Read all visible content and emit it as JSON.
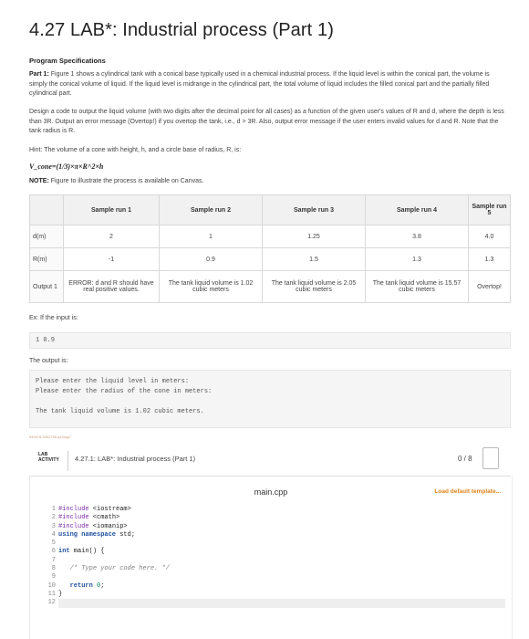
{
  "title": "4.27 LAB*: Industrial process (Part 1)",
  "spec": {
    "heading": "Program Specifications",
    "part1_label": "Part 1:",
    "part1_text": " Figure 1 shows a cylindrical tank with a conical base typically used in a chemical industrial process. If the liquid level is within the conical part, the volume is simply the conical volume of liquid. If the liquid level is midrange in the cylindrical part, the total volume of liquid includes the filled conical part and the partially filled cylindrical part.",
    "design_text": "Design a code to output the liquid volume (with two digits after the decimal point for all cases) as a function of the given user's values of R and d, where the depth is less than 3R. Output an error message (Overtop!) if you overtop the tank, i.e., d > 3R. Also, output error message if the user enters invalid values for d and R. Note that the tank radius is R.",
    "hint": "Hint: The volume of a cone with height, h, and a circle base of radius, R, is:",
    "formula": "V_cone=(1/3)×π×R^2×h",
    "note_label": "NOTE:",
    "note_text": " Figure to illustrate the process is available on Canvas."
  },
  "table": {
    "headers": [
      "",
      "Sample run 1",
      "Sample run 2",
      "Sample run 3",
      "Sample run 4",
      "Sample run 5"
    ],
    "rows": [
      {
        "label": "d(m)",
        "cells": [
          "2",
          "1",
          "1.25",
          "3.8",
          "4.0"
        ]
      },
      {
        "label": "R(m)",
        "cells": [
          "-1",
          "0.9",
          "1.5",
          "1.3",
          "1.3"
        ]
      },
      {
        "label": "Output 1",
        "cells": [
          "ERROR: d and R should have real positive values.",
          "The tank liquid volume is 1.02 cubic meters",
          "The tank liquid volume is 2.05 cubic meters",
          "The tank liquid volume is 15.57 cubic meters",
          "Overtop!"
        ]
      }
    ]
  },
  "example": {
    "input_label": "Ex: If the input is:",
    "input_value": "1 0.9",
    "output_label": "The output is:",
    "output_lines": [
      "Please enter the liquid level in meters:",
      "Please enter the radius of the cone in meters:",
      "",
      "The tank liquid volume is 1.02 cubic meters."
    ],
    "watermark": "449478.3062796.qx3zqy7"
  },
  "lab": {
    "tag_line1": "LAB",
    "tag_line2": "ACTIVITY",
    "name": "4.27.1: LAB*: Industrial process (Part 1)",
    "score": "0 / 8"
  },
  "editor": {
    "file_name": "main.cpp",
    "load_template": "Load default template...",
    "line_numbers": [
      "1",
      "2",
      "3",
      "4",
      "5",
      "6",
      "7",
      "8",
      "9",
      "10",
      "11",
      "12"
    ]
  },
  "colors": {
    "accent_orange": "#e2831b",
    "keyword_blue": "#1f4f9e"
  }
}
